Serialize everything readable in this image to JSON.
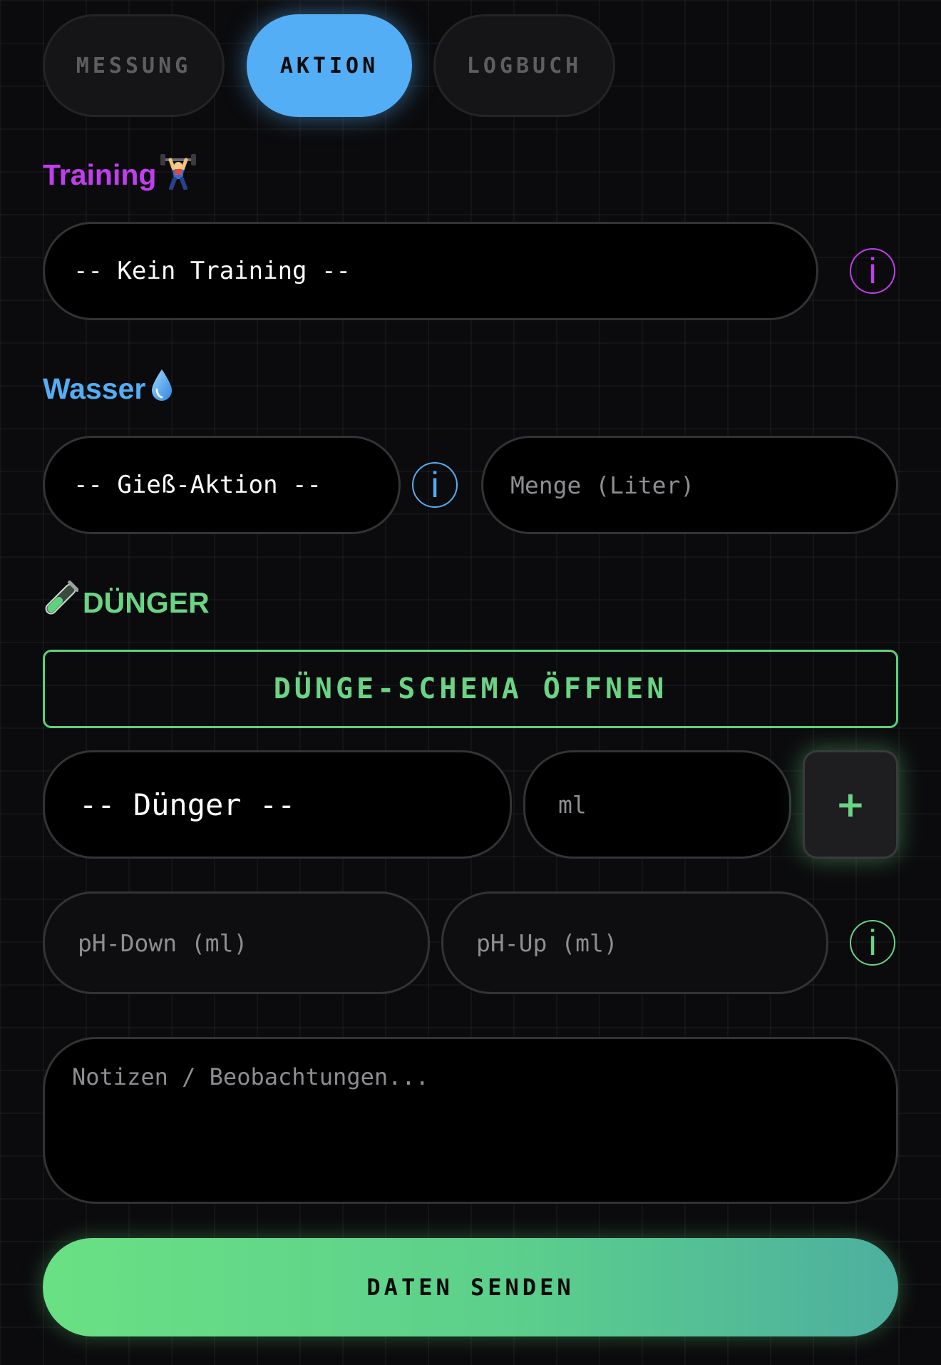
{
  "tabs": [
    {
      "label": "MESSUNG",
      "active": false
    },
    {
      "label": "AKTION",
      "active": true
    },
    {
      "label": "LOGBUCH",
      "active": false
    }
  ],
  "training": {
    "title": "Training",
    "icon": "weightlifter-icon",
    "selected": "-- Kein Training --",
    "info_symbol": "i",
    "accent_color": "#c23df0"
  },
  "water": {
    "title": "Wasser",
    "icon": "droplet-icon",
    "action_selected": "-- Gieß-Aktion --",
    "info_symbol": "i",
    "amount_placeholder": "Menge (Liter)",
    "accent_color": "#54aef5"
  },
  "fertilizer": {
    "title": "DÜNGER",
    "icon": "test-tube-icon",
    "schema_button": "DÜNGE-SCHEMA ÖFFNEN",
    "fertilizer_selected": "-- Dünger --",
    "ml_placeholder": "ml",
    "add_symbol": "+",
    "ph_down_placeholder": "pH-Down (ml)",
    "ph_up_placeholder": "pH-Up (ml)",
    "info_symbol": "i",
    "accent_color": "#6ad485"
  },
  "notes": {
    "placeholder": "Notizen / Beobachtungen..."
  },
  "submit": {
    "label": "DATEN SENDEN"
  }
}
